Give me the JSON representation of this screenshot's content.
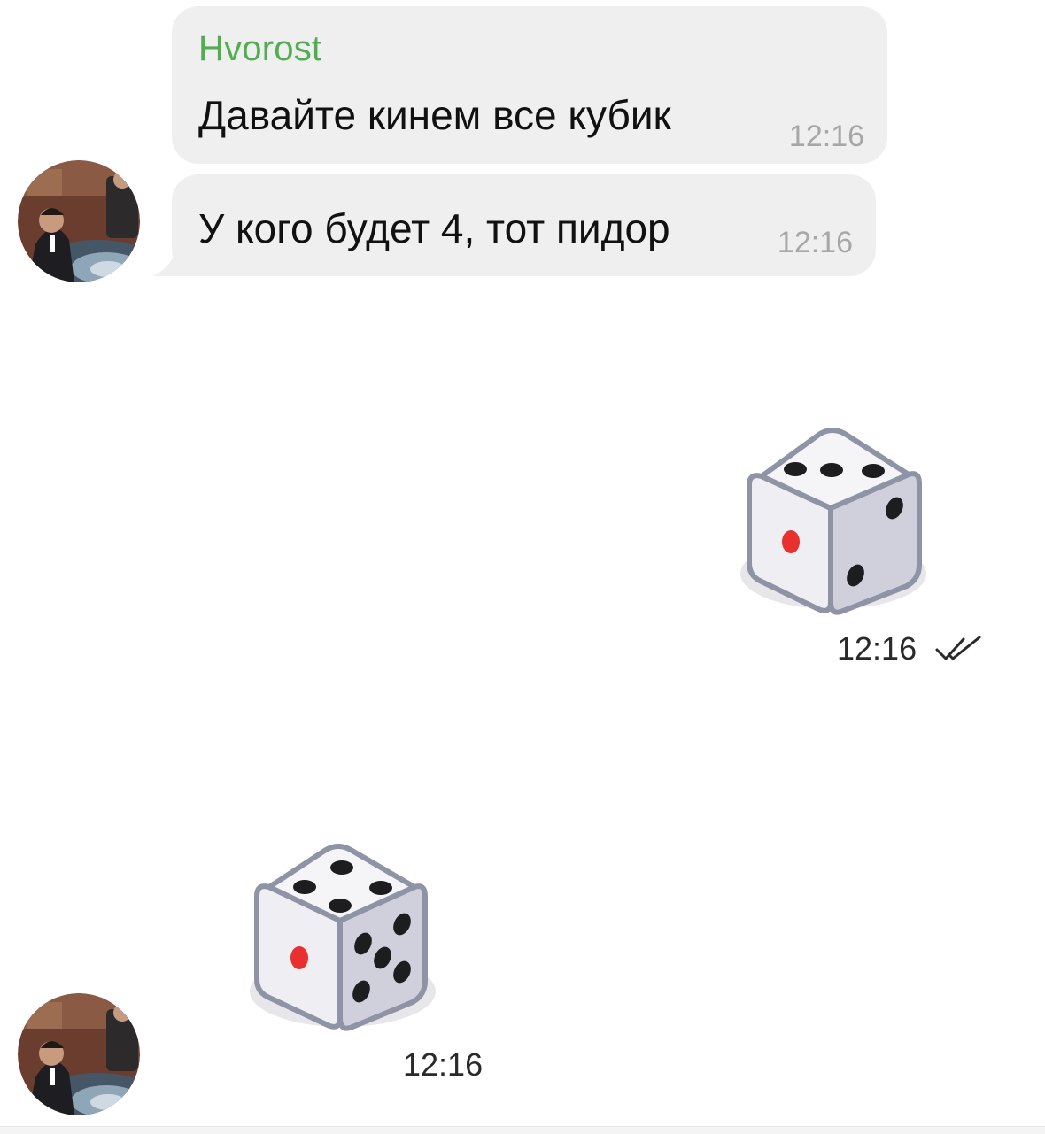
{
  "messages": [
    {
      "sender": "Hvorost",
      "text": "Давайте кинем все кубик",
      "time": "12:16"
    },
    {
      "text": "У кого будет 4, тот пидор",
      "time": "12:16"
    }
  ],
  "dice_outgoing": {
    "top_value": 3,
    "time": "12:16",
    "status": "read",
    "status_icon": "double-check-icon"
  },
  "dice_incoming": {
    "top_value": 4,
    "time": "12:16"
  },
  "colors": {
    "sender_name": "#4fae4e",
    "bubble": "#efefef",
    "time": "#a7a7a7",
    "dice_red_pip": "#e8312f"
  }
}
